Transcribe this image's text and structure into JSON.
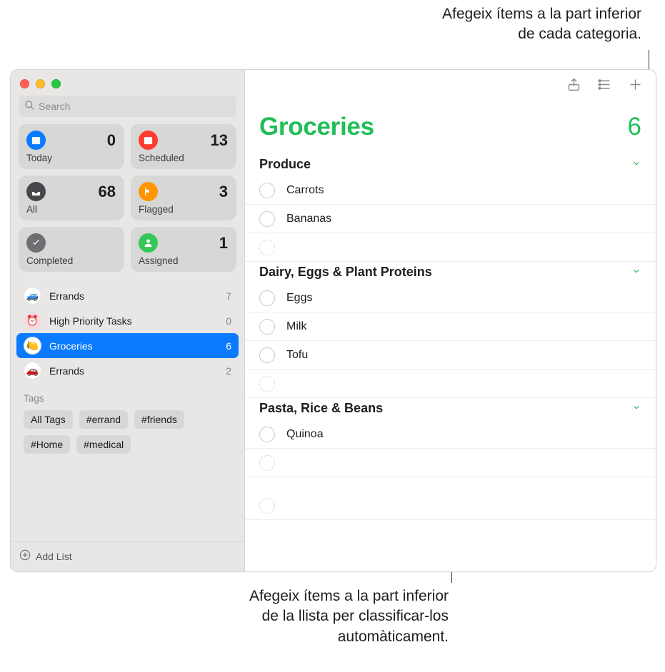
{
  "annotations": {
    "top": "Afegeix ítems a la part inferior\nde cada categoria.",
    "bottom": "Afegeix ítems a la part inferior\nde la llista per classificar-los\nautomàticament."
  },
  "sidebar": {
    "search_placeholder": "Search",
    "smart": [
      {
        "label": "Today",
        "count": "0",
        "color": "#0a7bff"
      },
      {
        "label": "Scheduled",
        "count": "13",
        "color": "#ff3b30"
      },
      {
        "label": "All",
        "count": "68",
        "color": "#47474b"
      },
      {
        "label": "Flagged",
        "count": "3",
        "color": "#ff9500"
      },
      {
        "label": "Completed",
        "count": "",
        "color": "#6f6f73"
      },
      {
        "label": "Assigned",
        "count": "1",
        "color": "#34c759"
      }
    ],
    "lists": [
      {
        "name": "Errands",
        "count": "7",
        "emoji": "🚙",
        "selected": false
      },
      {
        "name": "High Priority Tasks",
        "count": "0",
        "emoji": "⏰",
        "selected": false
      },
      {
        "name": "Groceries",
        "count": "6",
        "emoji": "🍋",
        "selected": true
      },
      {
        "name": "Errands",
        "count": "2",
        "emoji": "🚗",
        "selected": false
      }
    ],
    "tags_title": "Tags",
    "tags": [
      "All Tags",
      "#errand",
      "#friends",
      "#Home",
      "#medical"
    ],
    "add_list": "Add List"
  },
  "main": {
    "title": "Groceries",
    "count": "6",
    "sections": [
      {
        "title": "Produce",
        "items": [
          "Carrots",
          "Bananas"
        ]
      },
      {
        "title": "Dairy, Eggs & Plant Proteins",
        "items": [
          "Eggs",
          "Milk",
          "Tofu"
        ]
      },
      {
        "title": "Pasta, Rice & Beans",
        "items": [
          "Quinoa"
        ]
      }
    ]
  }
}
